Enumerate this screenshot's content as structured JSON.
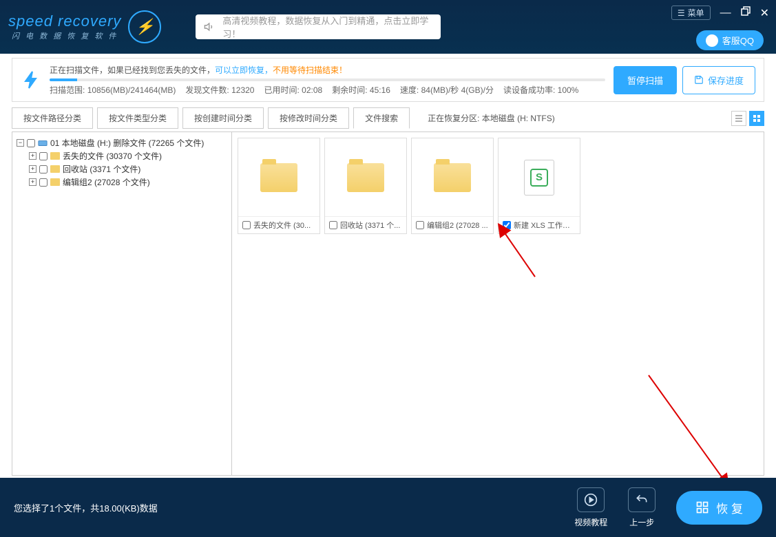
{
  "app": {
    "logo_main": "speed recovery",
    "logo_sub": "闪 电 数 据 恢 复 软 件"
  },
  "header": {
    "tutorial_text": "高清视频教程，数据恢复从入门到精通，点击立即学习！",
    "menu_label": "菜单",
    "support_label": "客服QQ"
  },
  "scan": {
    "title_prefix": "正在扫描文件，如果已经找到您丢失的文件，",
    "title_accent": "可以立即恢复，",
    "title_orange": "不用等待扫描结束！",
    "range_label": "扫描范围:",
    "range_value": "10856(MB)/241464(MB)",
    "found_label": "发现文件数:",
    "found_value": "12320",
    "elapsed_label": "已用时间:",
    "elapsed_value": "02:08",
    "remaining_label": "剩余时间:",
    "remaining_value": "45:16",
    "speed_label": "速度:",
    "speed_value": "84(MB)/秒  4(GB)/分",
    "success_label": "读设备成功率:",
    "success_value": "100%",
    "pause_btn": "暂停扫描",
    "save_btn": "保存进度"
  },
  "tabs": {
    "items": [
      "按文件路径分类",
      "按文件类型分类",
      "按创建时间分类",
      "按修改时间分类",
      "文件搜索"
    ],
    "partition_label": "正在恢复分区: 本地磁盘 (H: NTFS)"
  },
  "tree": {
    "root": "01 本地磁盘 (H:) 删除文件  (72265 个文件)",
    "children": [
      "丢失的文件   (30370 个文件)",
      "回收站   (3371 个文件)",
      "编辑组2   (27028 个文件)"
    ]
  },
  "files": [
    {
      "name": "丢失的文件  (30...",
      "type": "folder",
      "checked": false
    },
    {
      "name": "回收站  (3371 个...",
      "type": "folder",
      "checked": false
    },
    {
      "name": "编辑组2  (27028 ...",
      "type": "folder",
      "checked": false
    },
    {
      "name": "新建 XLS 工作表...",
      "type": "xls",
      "checked": true
    }
  ],
  "footer": {
    "status": "您选择了1个文件，共18.00(KB)数据",
    "video_label": "视频教程",
    "back_label": "上一步",
    "recover_label": "恢 复"
  }
}
